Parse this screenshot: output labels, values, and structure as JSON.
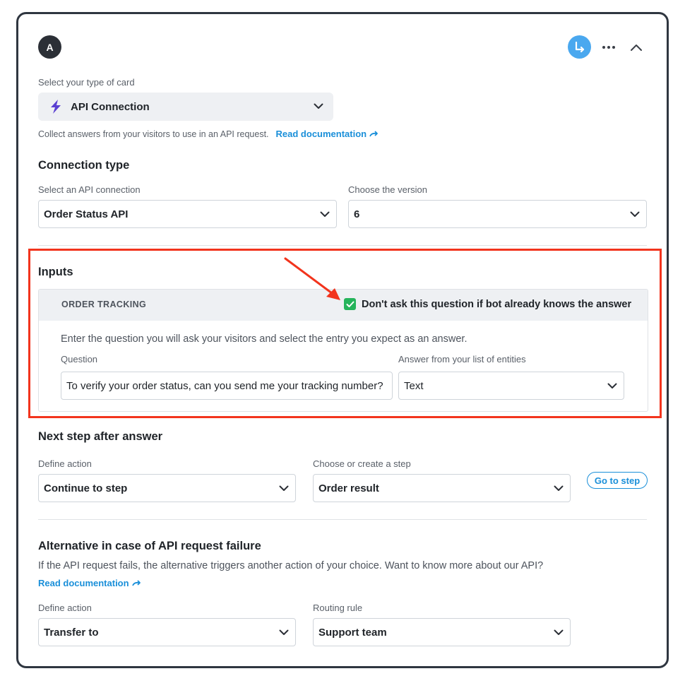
{
  "header": {
    "avatar_letter": "A"
  },
  "card_type": {
    "label": "Select your type of card",
    "selected": "API Connection",
    "description": "Collect answers from your visitors to use in an API request.",
    "doc_link": "Read documentation"
  },
  "connection": {
    "heading": "Connection type",
    "api_label": "Select an API connection",
    "api_value": "Order Status API",
    "version_label": "Choose the version",
    "version_value": "6"
  },
  "inputs": {
    "heading": "Inputs",
    "group_title": "ORDER TRACKING",
    "skip_checkbox_label": "Don't ask this question if bot already knows the answer",
    "help_text": "Enter the question you will ask your visitors and select the entry you expect as an answer.",
    "question_label": "Question",
    "question_value": "To verify your order status, can you send me your tracking number?",
    "answer_label": "Answer from your list of entities",
    "answer_value": "Text"
  },
  "next_step": {
    "heading": "Next step after answer",
    "action_label": "Define action",
    "action_value": "Continue to step",
    "step_label": "Choose or create a step",
    "step_value": "Order result",
    "go_button": "Go to step"
  },
  "failure": {
    "heading": "Alternative in case of API request failure",
    "description": "If the API request fails, the alternative triggers another action of your choice. Want to know more about our API?",
    "doc_link": "Read documentation",
    "action_label": "Define action",
    "action_value": "Transfer to",
    "routing_label": "Routing rule",
    "routing_value": "Support team"
  },
  "colors": {
    "accent": "#1a8fd9",
    "highlight": "#f2341d",
    "check": "#25b45b",
    "route_button": "#4aa8ef"
  }
}
